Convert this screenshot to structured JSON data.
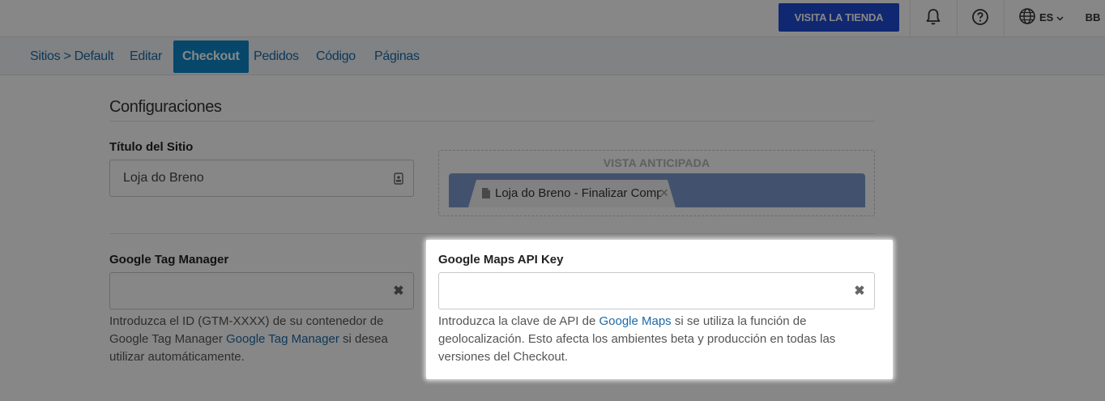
{
  "header": {
    "visit_store": "VISITA LA TIENDA",
    "language": "ES",
    "avatar": "BB"
  },
  "nav": {
    "breadcrumb": "Sitios > Default",
    "items": [
      {
        "label": "Editar"
      },
      {
        "label": "Checkout"
      },
      {
        "label": "Pedidos"
      },
      {
        "label": "Código"
      },
      {
        "label": "Páginas"
      }
    ],
    "active": "Checkout"
  },
  "section": {
    "title": "Configuraciones"
  },
  "site_title": {
    "label": "Título del Sitio",
    "value": "Loja do Breno"
  },
  "preview": {
    "label": "VISTA ANTICIPADA",
    "tab_title": "Loja do Breno - Finalizar Comp"
  },
  "gtm": {
    "label": "Google Tag Manager",
    "value": "",
    "help_before": "Introduzca el ID (GTM-XXXX) de su contenedor de Google Tag Manager ",
    "help_link": "Google Tag Manager",
    "help_after": " si desea utilizar automáticamente."
  },
  "maps": {
    "label": "Google Maps API Key",
    "value": "",
    "help_before": "Introduzca la clave de API de ",
    "help_link": "Google Maps",
    "help_after": " si se utiliza la función de geolocalización. Esto afecta los ambientes beta y producción en todas las versiones del Checkout."
  },
  "colors": {
    "primary_button": "#1f4bd6",
    "nav_active": "#0f86c9",
    "link": "#1b6aa8"
  }
}
